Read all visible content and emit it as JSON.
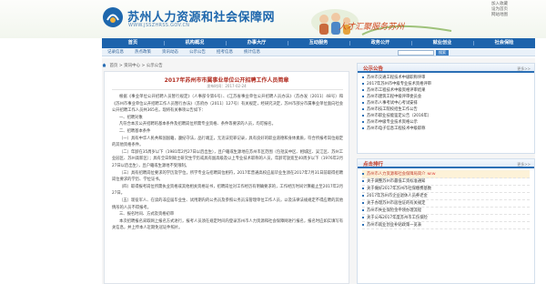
{
  "header": {
    "site_title": "苏州人力资源和社会保障网",
    "site_url": "WWW.JSSZHRSS.GOV.CN",
    "slogan": "人才汇聚服务苏州",
    "top_links": [
      "加入收藏",
      "设为首页",
      "网站地图"
    ]
  },
  "nav": {
    "items": [
      "首页",
      "机构概况",
      "办事大厅",
      "互动服务",
      "政务公开",
      "就业创业",
      "社会保险"
    ]
  },
  "subnav": {
    "items": [
      "记录信息",
      "热点政策",
      "资讯动态",
      "公示公告",
      "招考信息",
      "统计信息"
    ],
    "search_button": "搜索"
  },
  "breadcrumb": {
    "items": [
      "首页",
      "资讯中心",
      "公示公告"
    ],
    "separator": ">"
  },
  "article": {
    "title": "2017年苏州市市属事业单位公开招聘工作人员简章",
    "date": "发布时间：2017-02-24",
    "paragraphs": [
      "根据《事业单位公开招聘人员暂行规定》（人事部令第6号）、《江苏省事业单位公开招聘人员办法》（苏办发〔2011〕48号）和《苏州市事业单位公开招聘工作人员暂行办法》（苏府办〔2011〕127号）有关规定，经研究决定，苏州市部分市属事业单位面向社会公开招聘工作人员共365名，现将有关事项公告如下：",
      "一、招聘对象",
      "凡符合本次公开招聘的基本条件及招聘岗位所需专业资格、条件等要求的人员，均可报名。",
      "二、招聘基本条件",
      "（一）具有中华人民共和国国籍，遵纪守法，品行端正，无违法犯罪记录，具有良好的职业道德和身体素质，符合所报考岗位规定的其他资格条件。",
      "（二）年龄在35周岁以下（1981年2月27日以后出生），且户籍或生源地在苏州市区范围（包括吴中区、相城区、吴江区、苏州工业园区、苏州高新区）；具有全日制硕士研究生学历或具有副高级及以上专业技术职称的人员，年龄可放宽至40周岁以下（1976年2月27日以后出生），且户籍或生源地不受限制。",
      "（三）具有招聘岗位要求的学历及学位，所学专业与招聘岗位相符，2017年普通高校应届毕业生须在2017年7月31日前取得招聘岗位要求的学历、学位证书。",
      "（四）取得报考岗位所需执业资格或其他相关资格证书，招聘岗位对工作经历有明确要求的，工作经历时间计算截止至2017年2月27日。",
      "（五）现役军人、在读的非应届毕业生、试用期内的公务员及参照公务员法管理单位工作人员，以及法律法规规定不得应聘的其他情形的人员不得报考。",
      "三、报名时间、方式及资格初审",
      "本次招聘报名采取网上报名方式进行，报考人员须在规定时间内登录苏州市人力资源和社会保障网进行报名，报名时应如实填写有关信息，并上传本人近期免冠证件照片。"
    ]
  },
  "sidebar": {
    "notices": {
      "title": "公示公告",
      "more": "更多>>",
      "items": [
        "苏州市交通工程技术中级职称评审",
        "2017年苏州市中级专业技术资格评审",
        "苏州市工程技术中级资格评审结果",
        "苏州市建筑工程中级评审委员会",
        "苏州市人事考试中心考试安排",
        "苏州市技工院校招生工作公告",
        "苏州市职业技能鉴定公告（2016年）",
        "苏州市中级专业技术资格公示",
        "苏州市电子信息工程技术中级职称"
      ]
    },
    "highlights": {
      "title": "点击排行",
      "more": "更多>>",
      "items": [
        "苏州市人力资源和社会保障局简介",
        "关于调整苏州市最低工资标准通知",
        "关于做好2017年苏州市社保缴费基数",
        "2017年苏州市企业退休人员养老金",
        "关于办理苏州市居住证的有关规定",
        "苏州市失业保险金申领办理流程",
        "关于公布2017年度苏州市工伤保险",
        "苏州市就业创业补贴政策一览表"
      ],
      "new_badge": "NEW"
    }
  },
  "colors": {
    "brand_blue": "#1d63ac",
    "title_red": "#b12c20",
    "accent_orange": "#d0461c"
  }
}
